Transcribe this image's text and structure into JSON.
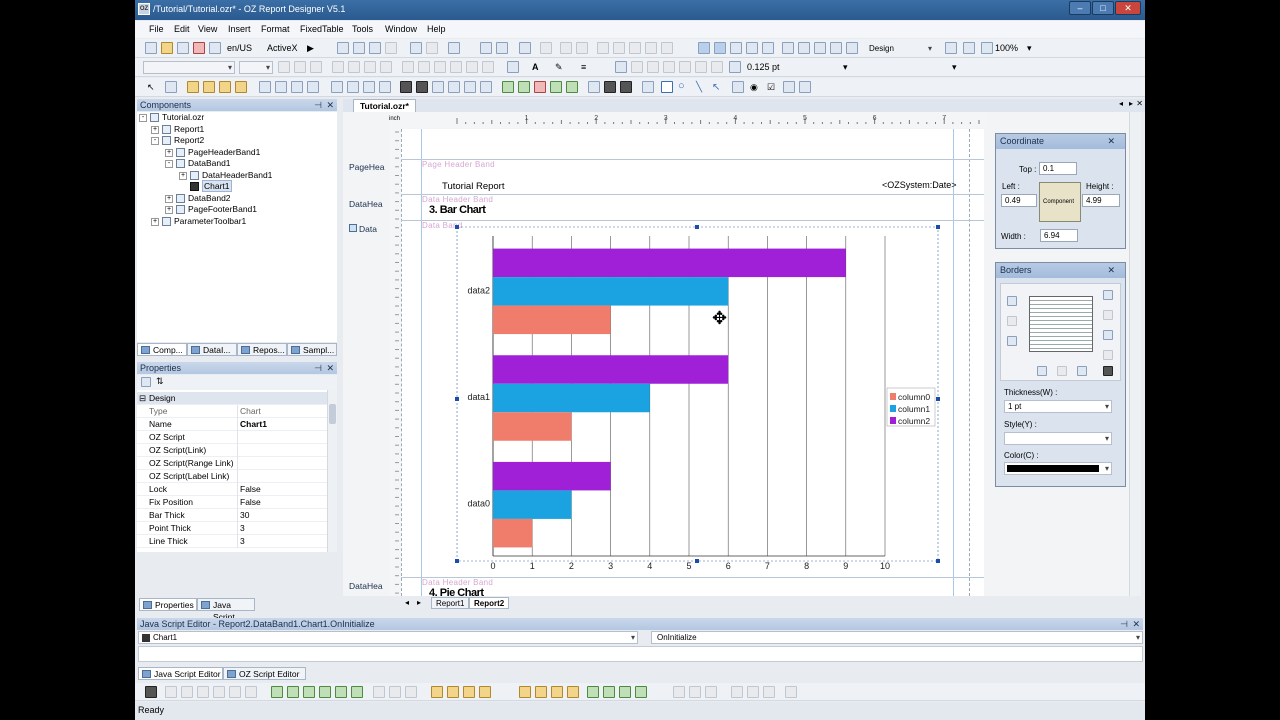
{
  "window": {
    "title": "/Tutorial/Tutorial.ozr* - OZ Report Designer V5.1",
    "app_icon": "OZ"
  },
  "menu": [
    "File",
    "Edit",
    "View",
    "Insert",
    "Format",
    "FixedTable",
    "Tools",
    "Window",
    "Help"
  ],
  "toolbar": {
    "locale": "en/US",
    "activex": "ActiveX",
    "mode": "Design",
    "zoom": "100%",
    "line_width": "0.125 pt"
  },
  "components_panel": {
    "title": "Components",
    "tree": [
      {
        "label": "Tutorial.ozr",
        "level": 0,
        "expander": "-"
      },
      {
        "label": "Report1",
        "level": 1,
        "expander": "+"
      },
      {
        "label": "Report2",
        "level": 1,
        "expander": "-"
      },
      {
        "label": "PageHeaderBand1",
        "level": 2,
        "expander": "+"
      },
      {
        "label": "DataBand1",
        "level": 2,
        "expander": "-"
      },
      {
        "label": "DataHeaderBand1",
        "level": 3,
        "expander": "+"
      },
      {
        "label": "Chart1",
        "level": 3,
        "expander": "",
        "selected": true
      },
      {
        "label": "DataBand2",
        "level": 2,
        "expander": "+"
      },
      {
        "label": "PageFooterBand1",
        "level": 2,
        "expander": "+"
      },
      {
        "label": "ParameterToolbar1",
        "level": 1,
        "expander": "+"
      }
    ],
    "tabs": [
      "Comp...",
      "DataI...",
      "Repos...",
      "Sampl..."
    ]
  },
  "properties_panel": {
    "title": "Properties",
    "category": "Design",
    "rows": [
      {
        "key": "Type",
        "value": "Chart"
      },
      {
        "key": "Name",
        "value": "Chart1"
      },
      {
        "key": "OZ Script",
        "value": ""
      },
      {
        "key": "OZ Script(Link)",
        "value": ""
      },
      {
        "key": "OZ Script(Range Link)",
        "value": ""
      },
      {
        "key": "OZ Script(Label Link)",
        "value": ""
      },
      {
        "key": "Lock",
        "value": "False"
      },
      {
        "key": "Fix Position",
        "value": "False"
      },
      {
        "key": "Bar Thick",
        "value": "30"
      },
      {
        "key": "Point Thick",
        "value": "3"
      },
      {
        "key": "Line Thick",
        "value": "3"
      }
    ],
    "tabs": [
      "Properties",
      "Java Script"
    ]
  },
  "document_tab": "Tutorial.ozr*",
  "ruler_unit": "inch",
  "ruler_labels": [
    "1",
    "2",
    "3",
    "4",
    "5",
    "6",
    "7",
    "8"
  ],
  "bands": {
    "page_header_label": "Page Header Band",
    "data_header_label": "Data Header Band",
    "data_band_label": "Data Band",
    "data_header_label_2": "Data Header Band",
    "left_page_header": "PageHea",
    "left_data_header": "DataHea",
    "left_data": "Data",
    "left_data_header_2": "DataHea"
  },
  "report": {
    "title_text": "Tutorial Report",
    "date_field": "<OZSystem:Date>",
    "section_title": "3. Bar Chart",
    "next_section_title": "4. Pie Chart"
  },
  "report_tabs": [
    "Report1",
    "Report2"
  ],
  "chart_data": {
    "type": "bar",
    "orientation": "horizontal",
    "categories": [
      "data0",
      "data1",
      "data2"
    ],
    "series": [
      {
        "name": "column0",
        "values": [
          1,
          2,
          3
        ],
        "color": "#f07c6c"
      },
      {
        "name": "column1",
        "values": [
          2,
          4,
          6
        ],
        "color": "#1aa3e0"
      },
      {
        "name": "column2",
        "values": [
          3,
          6,
          9
        ],
        "color": "#a020d8"
      }
    ],
    "xlim": [
      0,
      10
    ],
    "xticks": [
      "0",
      "1",
      "2",
      "3",
      "4",
      "5",
      "6",
      "7",
      "8",
      "9",
      "10"
    ],
    "grid": true,
    "legend": "right"
  },
  "coordinate_panel": {
    "title": "Coordinate",
    "top_label": "Top :",
    "top": "0.1",
    "left_label": "Left :",
    "left": "0.49",
    "height_label": "Height :",
    "height": "4.99",
    "width_label": "Width :",
    "width": "6.94",
    "component_label": "Component"
  },
  "borders_panel": {
    "title": "Borders",
    "thickness_label": "Thickness(W) :",
    "thickness": "1 pt",
    "style_label": "Style(Y) :",
    "style": "",
    "color_label": "Color(C) :",
    "color": "#000000"
  },
  "script_editor": {
    "title": "Java Script Editor - Report2.DataBand1.Chart1.OnInitialize",
    "object": "Chart1",
    "event": "OnInitialize",
    "tabs": [
      "Java Script Editor",
      "OZ Script Editor"
    ]
  },
  "status": "Ready"
}
